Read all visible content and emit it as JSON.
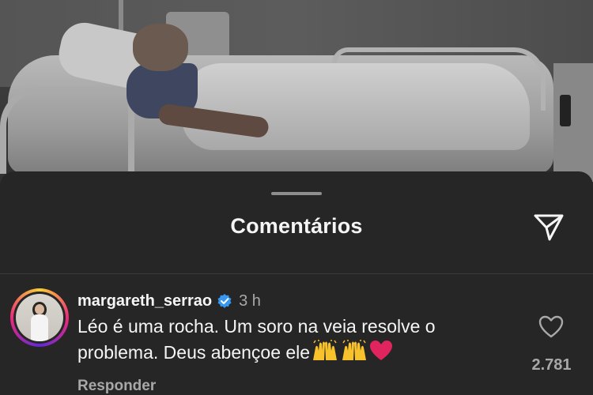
{
  "sheet": {
    "title": "Comentários"
  },
  "comment": {
    "username": "margareth_serrao",
    "time": "3 h",
    "text_line1": "Léo é uma rocha. Um soro na veia resolve o",
    "text_line2": "problema. Deus abençoe ele",
    "emojis": [
      "raising-hands",
      "raising-hands",
      "red-heart"
    ],
    "like_count": "2.781",
    "reply_label": "Responder",
    "verified": true
  },
  "colors": {
    "background": "#262626",
    "text": "#f5f5f5",
    "muted": "#a8a8a8",
    "verified_badge": "#3897f0",
    "heart_emoji": "#e0245e"
  }
}
